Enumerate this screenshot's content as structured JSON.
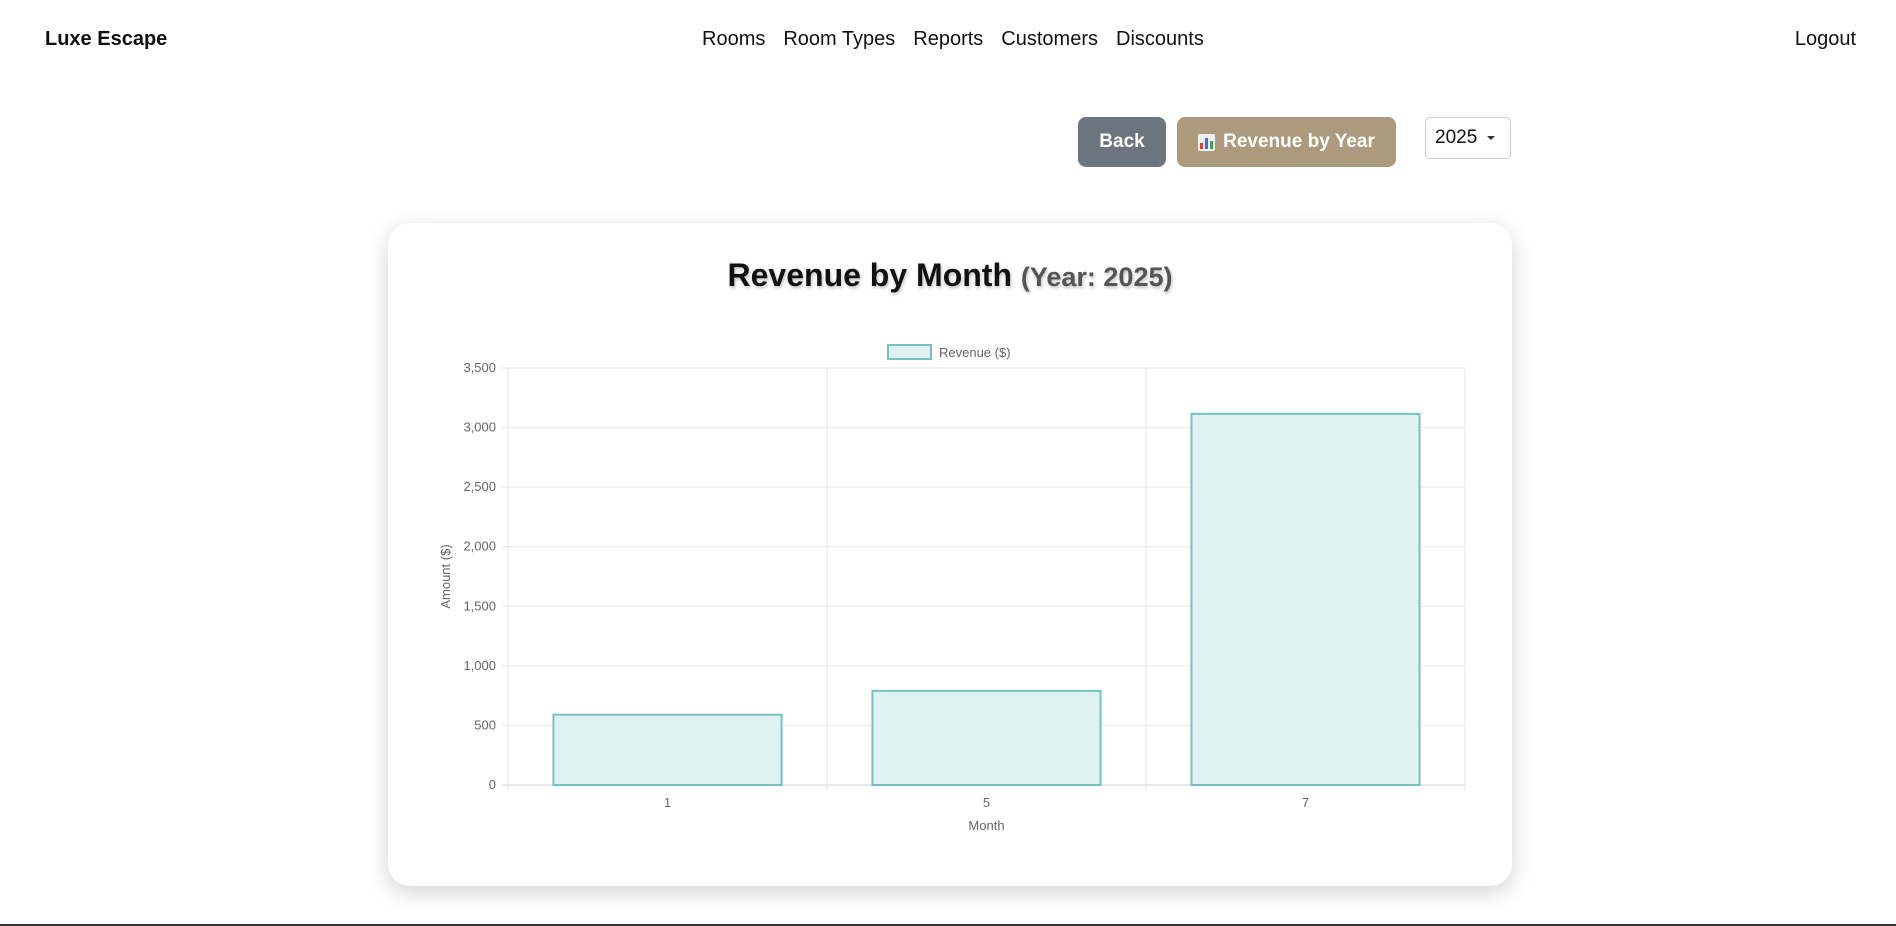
{
  "nav": {
    "brand": "Luxe Escape",
    "links": [
      "Rooms",
      "Room Types",
      "Reports",
      "Customers",
      "Discounts"
    ],
    "logout": "Logout"
  },
  "toolbar": {
    "back_label": "Back",
    "revenue_by_year_label": "Revenue by Year",
    "revenue_by_year_icon": "bar-chart-emoji-icon",
    "year_selected": "2025"
  },
  "card": {
    "title": "Revenue by Month",
    "subtitle": "(Year: 2025)"
  },
  "colors": {
    "back_button": "#6c757d",
    "revenue_button": "#ad9a7d",
    "bar_fill": "#e0f1f1",
    "bar_border": "#74c2c2"
  },
  "chart_data": {
    "type": "bar",
    "categories": [
      "1",
      "5",
      "7"
    ],
    "series": [
      {
        "name": "Revenue ($)",
        "values": [
          590,
          790,
          3115
        ]
      }
    ],
    "xlabel": "Month",
    "ylabel": "Amount ($)",
    "ylim": [
      0,
      3500
    ],
    "yticks": [
      0,
      500,
      1000,
      1500,
      2000,
      2500,
      3000,
      3500
    ],
    "ytick_labels": [
      "0",
      "500",
      "1,000",
      "1,500",
      "2,000",
      "2,500",
      "3,000",
      "3,500"
    ],
    "grid": true,
    "legend_position": "top-center"
  }
}
